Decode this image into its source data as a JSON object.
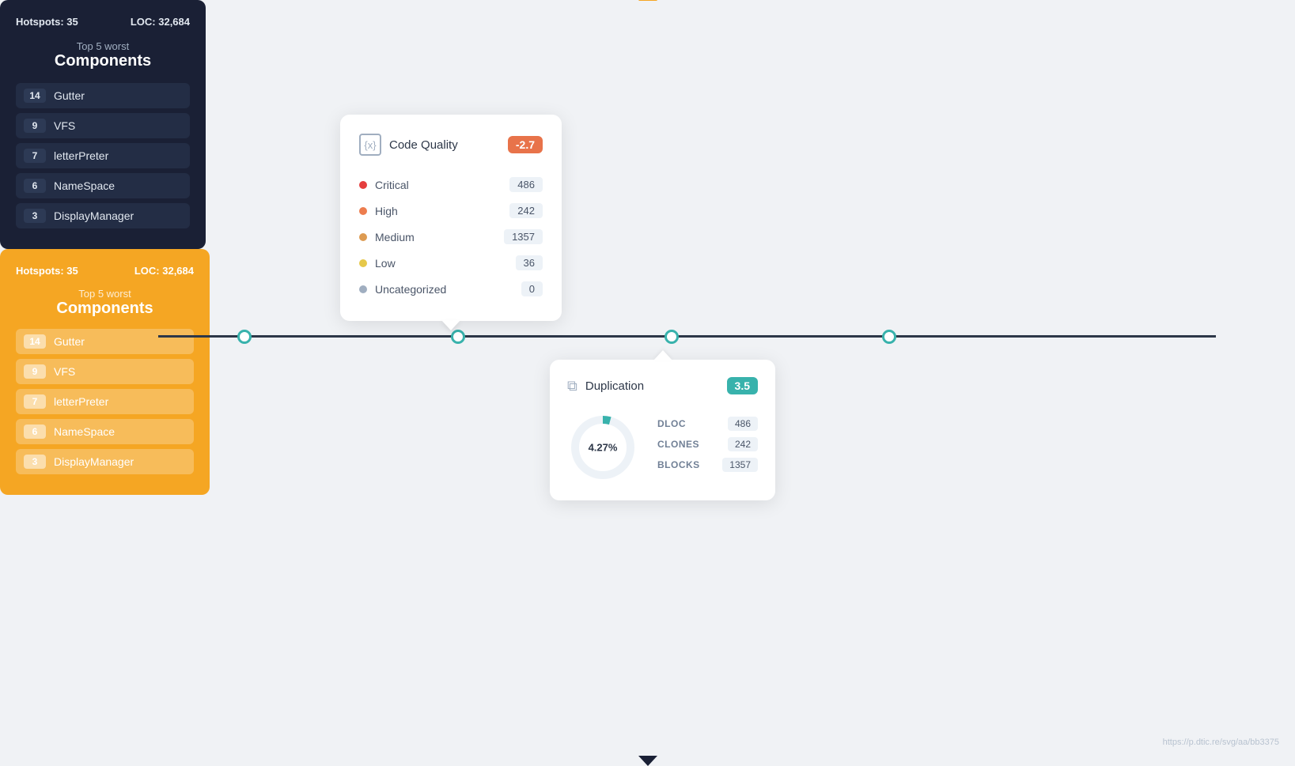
{
  "timeline": {
    "dots": [
      {
        "left": "18%"
      },
      {
        "left": "35%"
      },
      {
        "left": "52%"
      },
      {
        "left": "69%"
      }
    ]
  },
  "code_quality_card": {
    "icon": "{x}",
    "title": "Code Quality",
    "badge": "-2.7",
    "rows": [
      {
        "label": "Critical",
        "dot": "critical",
        "count": "486"
      },
      {
        "label": "High",
        "dot": "high",
        "count": "242"
      },
      {
        "label": "Medium",
        "dot": "medium",
        "count": "1357"
      },
      {
        "label": "Low",
        "dot": "low",
        "count": "36"
      },
      {
        "label": "Uncategorized",
        "dot": "uncategorized",
        "count": "0"
      }
    ]
  },
  "dark_card": {
    "hotspots_label": "Hotspots:",
    "hotspots_value": "35",
    "loc_label": "LOC:",
    "loc_value": "32,684",
    "subtitle_top": "Top 5 worst",
    "subtitle_main": "Components",
    "items": [
      {
        "num": "14",
        "name": "Gutter"
      },
      {
        "num": "9",
        "name": "VFS"
      },
      {
        "num": "7",
        "name": "letterPreter"
      },
      {
        "num": "6",
        "name": "NameSpace"
      },
      {
        "num": "3",
        "name": "DisplayManager"
      }
    ]
  },
  "orange_card": {
    "hotspots_label": "Hotspots:",
    "hotspots_value": "35",
    "loc_label": "LOC:",
    "loc_value": "32,684",
    "subtitle_top": "Top 5 worst",
    "subtitle_main": "Components",
    "items": [
      {
        "num": "14",
        "name": "Gutter"
      },
      {
        "num": "9",
        "name": "VFS"
      },
      {
        "num": "7",
        "name": "letterPreter"
      },
      {
        "num": "6",
        "name": "NameSpace"
      },
      {
        "num": "3",
        "name": "DisplayManager"
      }
    ]
  },
  "duplication_card": {
    "icon": "⧉",
    "title": "Duplication",
    "badge": "3.5",
    "donut_percent": "4.27%",
    "stats": [
      {
        "label": "DLOC",
        "value": "486"
      },
      {
        "label": "CLONES",
        "value": "242"
      },
      {
        "label": "BLOCKS",
        "value": "1357"
      }
    ]
  },
  "watermark": "https://p.dtic.re/svg/aa/bb3375"
}
